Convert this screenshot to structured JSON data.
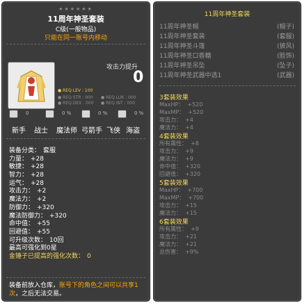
{
  "item": {
    "stars": "★★★★★★",
    "name": "11周年神圣套装",
    "grade": "C级(一般物品)",
    "bind_note": "只能在同一账号内移动",
    "attack_increase_label": "攻击力提升",
    "attack_increase_value": "0",
    "req_lev": "● REQ LEV : 100",
    "req_stats": [
      [
        "● REQ STR : 000",
        "● REQ LUK : 000"
      ],
      [
        "● REQ DEX : 000",
        "● REQ INT : 000"
      ]
    ],
    "small_values": [
      "0",
      "0 %",
      "0 %",
      "0 %"
    ],
    "jobs": [
      "新手",
      "战士",
      "魔法师",
      "弓箭手",
      "飞侠",
      "海盗"
    ],
    "stats": [
      {
        "label": "装备分类：",
        "value": "套服"
      },
      {
        "label": "力量：",
        "value": "+28"
      },
      {
        "label": "敏捷：",
        "value": "+28"
      },
      {
        "label": "智力：",
        "value": "+28"
      },
      {
        "label": "运气：",
        "value": "+28"
      },
      {
        "label": "攻击力：",
        "value": "+2"
      },
      {
        "label": "魔法力：",
        "value": "+2"
      },
      {
        "label": "防御力：",
        "value": "+320"
      },
      {
        "label": "魔法防御力：",
        "value": "+320"
      },
      {
        "label": "命中值：",
        "value": "+55"
      },
      {
        "label": "回避值：",
        "value": "+55"
      },
      {
        "label": "可升级次数：",
        "value": "10回"
      },
      {
        "label": "最高可强化到0星",
        "value": ""
      },
      {
        "label": "金锤子已提高的强化次数：",
        "value": "0"
      }
    ],
    "footer_white1": "装备前放入仓库，",
    "footer_orange": "账号下的角色之间可以共享1次",
    "footer_white2": "，之后无法交易。"
  },
  "set": {
    "title": "11周年神圣套装",
    "pieces": [
      {
        "name": "11周年神圣帽",
        "slot": "(帽子)"
      },
      {
        "name": "11周年神圣套装",
        "slot": "(套服)"
      },
      {
        "name": "11周年神圣斗篷",
        "slot": "(披风)"
      },
      {
        "name": "11周年神圣口香糖",
        "slot": "(脸饰)"
      },
      {
        "name": "11周年神圣吊坠",
        "slot": "(坠子)"
      },
      {
        "name": "11周年神圣武器中选1",
        "slot": "(武器)"
      }
    ],
    "effects": [
      {
        "head": "3套装效果",
        "lines": [
          {
            "label": "MaxHP：",
            "value": "+520"
          },
          {
            "label": "MaxMP：",
            "value": "+520"
          },
          {
            "label": "攻击力：",
            "value": "+4"
          },
          {
            "label": "魔法力：",
            "value": "+4"
          }
        ]
      },
      {
        "head": "4套装效果",
        "lines": [
          {
            "label": "所有属性：",
            "value": "+8"
          },
          {
            "label": "攻击力：",
            "value": "+9"
          },
          {
            "label": "魔法力：",
            "value": "+9"
          },
          {
            "label": "命中值：",
            "value": "+320"
          },
          {
            "label": "回避值：",
            "value": "+320"
          }
        ]
      },
      {
        "head": "5套装效果",
        "lines": [
          {
            "label": "MaxHP：",
            "value": "+700"
          },
          {
            "label": "MaxMP：",
            "value": "+700"
          },
          {
            "label": "攻击力：",
            "value": "+15"
          },
          {
            "label": "魔法力：",
            "value": "+15"
          }
        ]
      },
      {
        "head": "6套装效果",
        "lines": [
          {
            "label": "所有属性：",
            "value": "+9"
          },
          {
            "label": "攻击力：",
            "value": "+21"
          },
          {
            "label": "魔法力：",
            "value": "+21"
          },
          {
            "label": "总伤害：",
            "value": "+9%"
          }
        ]
      }
    ]
  },
  "colors": {
    "panel": "#3b3b3b",
    "set_title": "#f2d65a",
    "bind_note": "#ffa500",
    "inactive": "#8c8c8c"
  }
}
